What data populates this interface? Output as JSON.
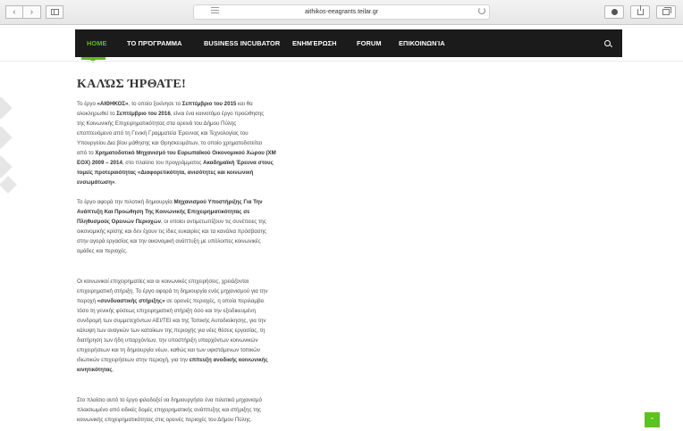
{
  "browser": {
    "url": "aithikos-eeagrants.teilar.gr",
    "back_glyph": "‹",
    "forward_glyph": "›"
  },
  "nav": {
    "home": "HOME",
    "program": "ΤΟ ΠΡΌΓΡΑΜΜΑ",
    "incubator": "BUSINESS INCUBATOR",
    "news": "ΕΝΗΜΈΡΩΣΗ",
    "forum": "FORUM",
    "contact": "ΕΠΙΚΟΙΝΩΝΊΑ"
  },
  "article": {
    "title": "ΚΑΛΏΣ ΉΡΘΑΤΕ!",
    "p1": [
      [
        {
          "t": "Το έργο "
        },
        {
          "t": "«ΑΙΘΗΚΟΣ»",
          "b": true
        },
        {
          "t": ", το οποίο ξεκίνησε το "
        },
        {
          "t": "Σεπτέμβριο του 2015",
          "b": true
        },
        {
          "t": " και θα"
        }
      ],
      [
        {
          "t": "ολοκληρωθεί το "
        },
        {
          "t": "Σεπτέμβριο του 2016",
          "b": true
        },
        {
          "t": ", είναι ένα καινοτόμο έργο προώθησης"
        }
      ],
      [
        {
          "t": "της Κοινωνικής Επιχειρηματικότητας στα ορεινά του Δήμου Πύλης"
        }
      ],
      [
        {
          "t": "εποπτευόμενο από τη Γενική Γραμματεία Έρευνας και Τεχνολογίας του"
        }
      ],
      [
        {
          "t": "Υπουργείου Δια βίου μάθησης και Θρησκευμάτων, το οποίο χρηματοδοτείται"
        }
      ],
      [
        {
          "t": "από το "
        },
        {
          "t": "Χρηματοδοτικό Μηχανισμό του Ευρωπαϊκού Οικονομικού Χώρου (ΧΜ",
          "b": true
        }
      ],
      [
        {
          "t": "ΕΟΧ) 2009 – 2014",
          "b": true
        },
        {
          "t": ", στο πλαίσιο του προγράμματος "
        },
        {
          "t": "Ακαδημαϊκή Έρευνα στους",
          "b": true
        }
      ],
      [
        {
          "t": "τομείς προτεραιότητας «Διαφορετικότητα, ανισότητες και κοινωνική",
          "b": true
        }
      ],
      [
        {
          "t": "ενσωμάτωση»",
          "b": true
        },
        {
          "t": "."
        }
      ]
    ],
    "p2": [
      [
        {
          "t": "Το έργο αφορά την πιλοτική δημιουργία "
        },
        {
          "t": "Μηχανισμού Υποστήριξης Για Την",
          "b": true
        }
      ],
      [
        {
          "t": "Ανάπτυξη Και Προώθηση Της Κοινωνικής Επιχειρηματικότητας σε",
          "b": true
        }
      ],
      [
        {
          "t": "Πληθυσμούς Ορεινών Περιοχών",
          "b": true
        },
        {
          "t": ", οι οποίοι αντιμετωπίζουν τις συνέπειες της"
        }
      ],
      [
        {
          "t": "οικονομικής κρίσης και δεν έχουν τις ίδιες ευκαιρίες και τα κανάλια πρόσβασης"
        }
      ],
      [
        {
          "t": "στην αγορά εργασίας και την οικονομική ανάπτυξη με υπόλοιπες κοινωνικές"
        }
      ],
      [
        {
          "t": "ομάδες και περιοχές."
        }
      ]
    ],
    "p3": [
      [
        {
          "t": "Οι κοινωνικοί επιχειρηματίες και οι κοινωνικές επιχειρήσεις, χρειάζονται"
        }
      ],
      [
        {
          "t": "επιχειρηματική στήριξη. Το έργο αφορά τη δημιουργία ενός μηχανισμού για την"
        }
      ],
      [
        {
          "t": "παροχή "
        },
        {
          "t": "«συνδυαστικής στήριξης»",
          "b": true
        },
        {
          "t": " σε ορεινές περιοχές, η οποία περιλαμβει"
        }
      ],
      [
        {
          "t": "τόσο τη γενικής φύσεως επιχειρηματική στήριξη όσο και την εξειδικευμένη"
        }
      ],
      [
        {
          "t": "συνδρομή των συμμετεχόντων ΑΕΙ/ΤΕΙ και της Τοπικής Αυτοδιοίκησης, για την"
        }
      ],
      [
        {
          "t": "κάλυψη των αναγκών των κατοίκων της περιοχής για νέες θέσεις εργασίας, τη"
        }
      ],
      [
        {
          "t": "διατήρηση των ήδη υπαρχόντων, την υποστήριξη υπαρχόντων κοινωνικών"
        }
      ],
      [
        {
          "t": "επιχειρήσεων και τη δημιουργία νέων, καθώς και των υφιστάμενων τοπικών"
        }
      ],
      [
        {
          "t": "ιδιωτικών επιχειρήσεων στην περιοχή, για την "
        },
        {
          "t": "επίτευξη ανοδικής κοινωνικής",
          "b": true
        }
      ],
      [
        {
          "t": "κινητικότητας",
          "b": true
        },
        {
          "t": "."
        }
      ]
    ],
    "p4": [
      [
        {
          "t": "Στο πλαίσιο αυτό το έργο φιλοδοξεί να δημιουργήσει ένα πιλοτικό μηχανισμό"
        }
      ],
      [
        {
          "t": "πλαισιωμένο από ειδικές δομές επιχειρηματικής ανάπτυξης και στήριξης της"
        }
      ],
      [
        {
          "t": "κοινωνικής επιχειρηματικότητας στις ορεινές περιοχές του Δήμου Πύλης."
        }
      ]
    ]
  },
  "scroll_top_glyph": "⌃",
  "colors": {
    "accent": "#63b82a",
    "nav_bg": "#1b1b1b"
  },
  "icons": [
    "sidebar-icon",
    "reader-icon",
    "reload-icon",
    "download-icon",
    "share-icon",
    "tabs-icon",
    "search-icon",
    "chevron-up-icon"
  ]
}
